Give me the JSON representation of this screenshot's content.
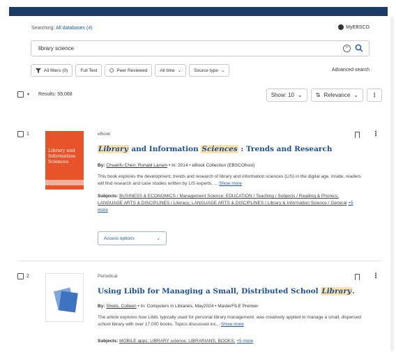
{
  "header": {
    "searching_label": "Searching:",
    "database_link": "All databases (4)",
    "my_account": "MyEBSCO"
  },
  "search": {
    "query": "library science"
  },
  "filters": {
    "all_filters": "All filters (0)",
    "full_text": "Full Text",
    "peer_reviewed": "Peer Reviewed",
    "all_time": "All time",
    "source_type": "Source type",
    "advanced": "Advanced search"
  },
  "results_bar": {
    "count": "Results: 59,068",
    "show": "Show: 10",
    "sort": "Relevance"
  },
  "results": [
    {
      "num": "1",
      "type": "eBook",
      "title_a": "Library",
      "title_b": " and Information ",
      "title_c": "Sciences",
      "title_d": " : Trends and Research",
      "by_label": "By:",
      "authors": "Chuanfu Chen; Ronald Larsen",
      "in_info": " • In: 2014 • eBook Collection (EBSCOhost)",
      "abstract": "This book explores the development, trends and research of library and information sciences (LIS) in the digital age. Inside, readers will find research and case studies written by LIS experts, ...",
      "show_more": "Show more",
      "subjects_label": "Subjects:",
      "subjects": "BUSINESS & ECONOMICS / Management Science; EDUCATION / Teaching / Subjects / Reading & Phonics; LANGUAGE ARTS & DISCIPLINES / Literacy; LANGUAGE ARTS & DISCIPLINES / Library & Information Science / General",
      "subjects_more": "+5 more",
      "access": "Access options",
      "cover_title": "Library and Information Sciences"
    },
    {
      "num": "2",
      "type": "Periodical",
      "title_a": "Using Libib for Managing a Small, Distributed School ",
      "title_b": "Library",
      "title_c": ".",
      "by_label": "By:",
      "authors": "Sheils, Colleen",
      "in_info": " • In: Computers in Libraries, May2024 • MasterFILE Premier",
      "abstract": "The article explores how Libib, typically used for personal library management, was creatively applied to manage a small, dispersed school library with over 17,000 books. Topics discussed inc...",
      "show_more": "Show more",
      "subjects_label": "Subjects:",
      "subjects": "MOBILE apps; LIBRARY science; LIBRARIANS; BOOKS;",
      "subjects_more": "+5 more"
    }
  ],
  "colors": {
    "topbar": "#1c3a66",
    "link": "#1a5aa8",
    "highlight": "#fbe2a8",
    "cover": "#e8542a"
  }
}
